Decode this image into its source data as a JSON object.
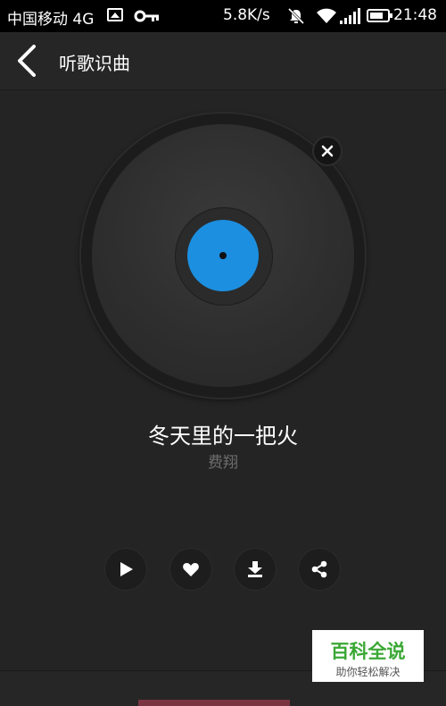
{
  "status_bar": {
    "carrier": "中国移动 4G",
    "speed": "5.8K/s",
    "time": "21:48"
  },
  "header": {
    "title": "听歌识曲"
  },
  "song": {
    "title": "冬天里的一把火",
    "artist": "费翔"
  },
  "record": {
    "label_color": "#1c8fe0"
  },
  "actions": {
    "icons": [
      "play-icon",
      "heart-icon",
      "download-icon",
      "share-icon"
    ]
  },
  "watermark": {
    "title": "百科全说",
    "subtitle": "助你轻松解决"
  }
}
